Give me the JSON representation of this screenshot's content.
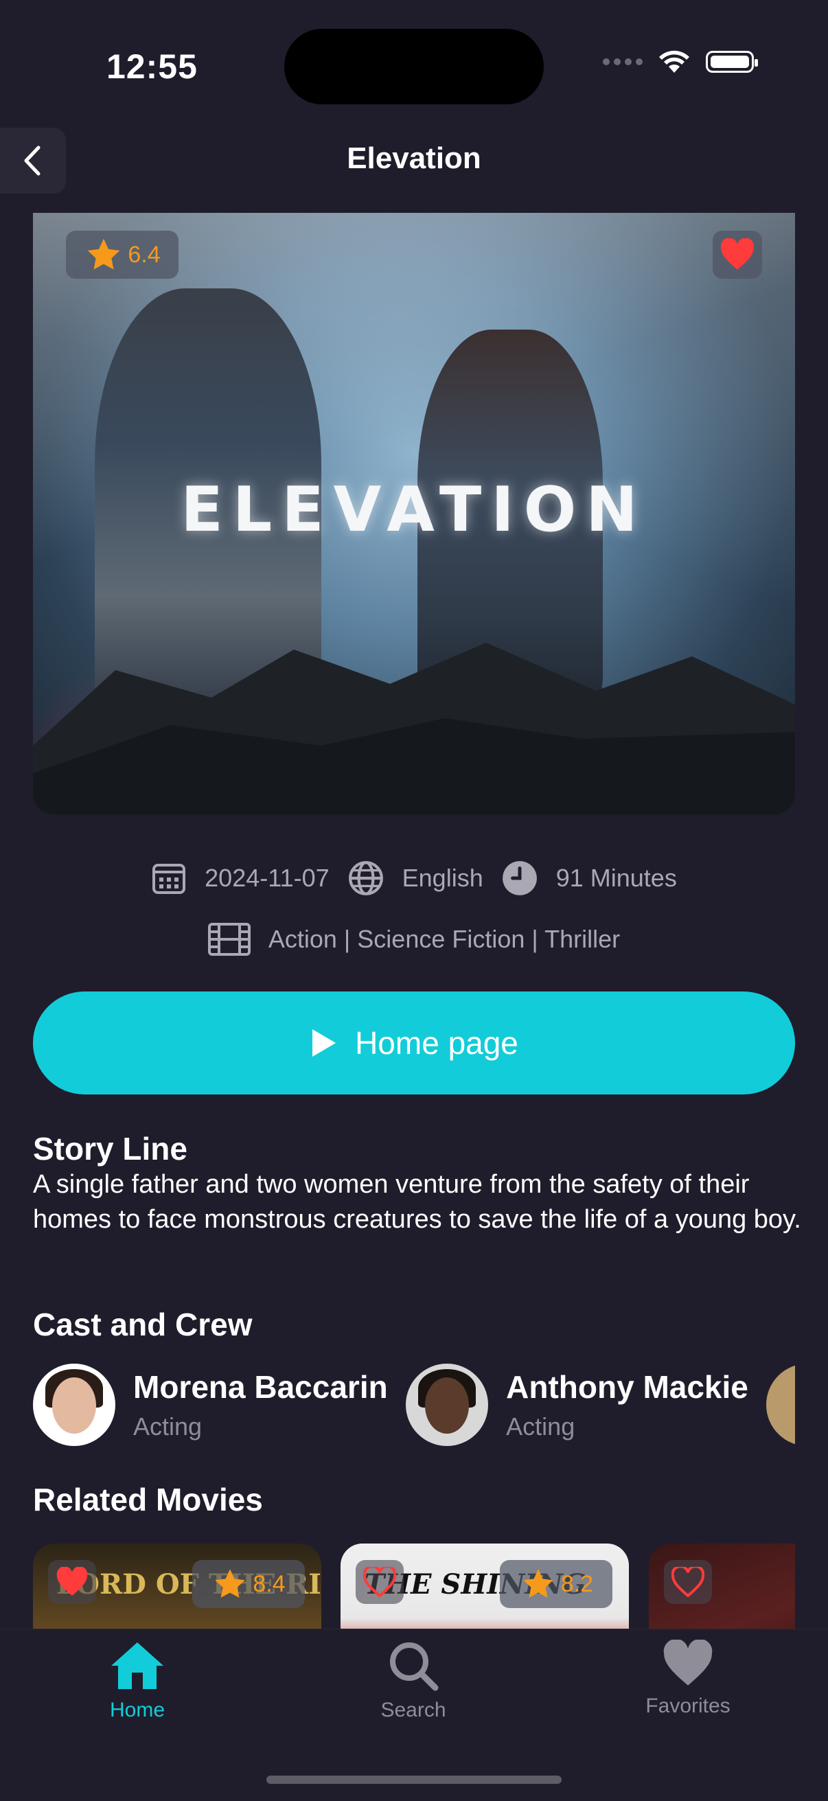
{
  "status_bar": {
    "time": "12:55"
  },
  "nav": {
    "title": "Elevation"
  },
  "poster": {
    "title_art": "ELEVATION",
    "rating": "6.4",
    "favorite_active": true
  },
  "meta": {
    "date": "2024-11-07",
    "language": "English",
    "duration": "91 Minutes",
    "genres": "Action | Science Fiction | Thriller"
  },
  "home_button": {
    "label": "Home page"
  },
  "story": {
    "title": "Story Line",
    "text": "A single father and two women venture from the safety of their homes to face monstrous creatures to save the life of a young boy."
  },
  "cast": {
    "title": "Cast and Crew",
    "items": [
      {
        "name": "Morena Baccarin",
        "role": "Acting"
      },
      {
        "name": "Anthony Mackie",
        "role": "Acting"
      }
    ]
  },
  "related": {
    "title": "Related Movies",
    "items": [
      {
        "logo": "LORD OF THE RINGS",
        "rating": "8.4",
        "favorite": true
      },
      {
        "logo": "THE SHINING",
        "rating": "8.2",
        "favorite": false
      },
      {
        "logo": "",
        "rating": "",
        "favorite": false
      }
    ]
  },
  "tabs": [
    {
      "label": "Home",
      "active": true
    },
    {
      "label": "Search",
      "active": false
    },
    {
      "label": "Favorites",
      "active": false
    }
  ],
  "colors": {
    "background": "#1f1d2b",
    "accent": "#12cdd9",
    "rating": "#f59a1b",
    "favorite": "#ff3b3b",
    "muted_text": "#a9a8b3"
  }
}
